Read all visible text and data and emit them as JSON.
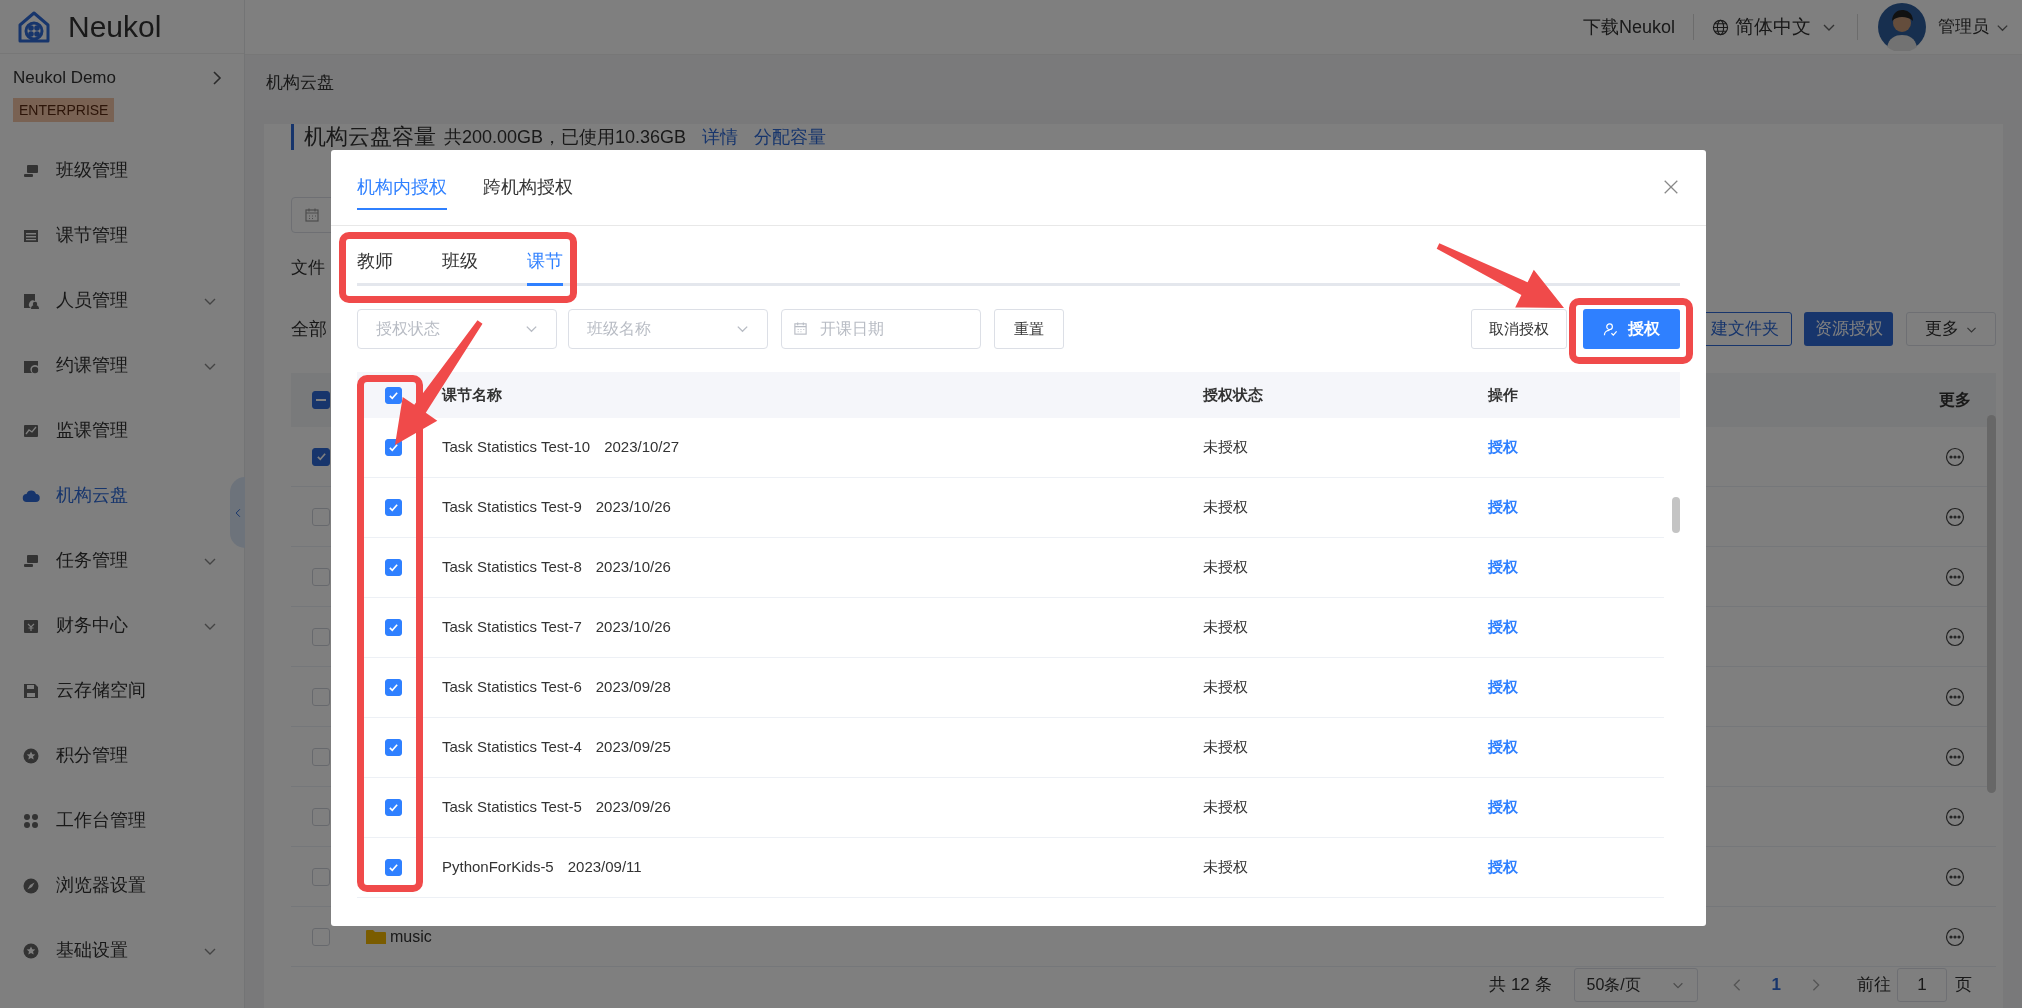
{
  "header": {
    "brand": "Neukol",
    "download": "下载Neukol",
    "language": "简体中文",
    "user": "管理员"
  },
  "sidebar": {
    "org": "Neukol Demo",
    "edition": "ENTERPRISE",
    "items": [
      {
        "label": "班级管理",
        "expandable": false,
        "selected": false
      },
      {
        "label": "课节管理",
        "expandable": false,
        "selected": false
      },
      {
        "label": "人员管理",
        "expandable": true,
        "selected": false
      },
      {
        "label": "约课管理",
        "expandable": true,
        "selected": false
      },
      {
        "label": "监课管理",
        "expandable": false,
        "selected": false
      },
      {
        "label": "机构云盘",
        "expandable": false,
        "selected": true
      },
      {
        "label": "任务管理",
        "expandable": true,
        "selected": false
      },
      {
        "label": "财务中心",
        "expandable": true,
        "selected": false
      },
      {
        "label": "云存储空间",
        "expandable": false,
        "selected": false
      },
      {
        "label": "积分管理",
        "expandable": false,
        "selected": false
      },
      {
        "label": "工作台管理",
        "expandable": false,
        "selected": false
      },
      {
        "label": "浏览器设置",
        "expandable": false,
        "selected": false
      },
      {
        "label": "基础设置",
        "expandable": true,
        "selected": false
      }
    ]
  },
  "breadcrumb": "机构云盘",
  "storage": {
    "title": "机构云盘容量",
    "usage": "共200.00GB，已使用10.36GB",
    "links": [
      "详情",
      "分配容量"
    ]
  },
  "file_label": "文件",
  "all_label": "全部",
  "actions": [
    {
      "label": "建文件夹",
      "kind": "outline"
    },
    {
      "label": "资源授权",
      "kind": "primary"
    },
    {
      "label": "更多",
      "kind": "dropdown"
    }
  ],
  "files": {
    "more_header": "更多",
    "header_indeterminate": true,
    "rows": [
      {
        "checked": true
      },
      {
        "checked": false
      },
      {
        "checked": false
      },
      {
        "checked": false
      },
      {
        "checked": false
      },
      {
        "checked": false
      },
      {
        "checked": false
      },
      {
        "checked": false
      },
      {
        "checked": false,
        "kind": "folder",
        "name": "music"
      }
    ]
  },
  "pagination": {
    "total": "共 12 条",
    "page_size": "50条/页",
    "pages": [
      {
        "label": "1",
        "selected": true
      }
    ],
    "goto_label": "前往",
    "goto_value": "1",
    "page_label": "页"
  },
  "dialog": {
    "tabs": [
      {
        "label": "机构内授权",
        "selected": true
      },
      {
        "label": "跨机构授权",
        "selected": false
      }
    ],
    "subtabs": [
      {
        "label": "教师",
        "selected": false
      },
      {
        "label": "班级",
        "selected": false
      },
      {
        "label": "课节",
        "selected": true
      }
    ],
    "filters": [
      {
        "kind": "select",
        "placeholder": "授权状态"
      },
      {
        "kind": "select",
        "placeholder": "班级名称"
      },
      {
        "kind": "date",
        "placeholder": "开课日期"
      }
    ],
    "reset": "重置",
    "revoke": "取消授权",
    "grant": "授权",
    "table": {
      "columns": [
        "课节名称",
        "授权状态",
        "操作"
      ],
      "all_checked": true,
      "rows": [
        {
          "name": "Task Statistics Test-10",
          "date": "2023/10/27",
          "status": "未授权",
          "action": "授权",
          "checked": true
        },
        {
          "name": "Task Statistics Test-9",
          "date": "2023/10/26",
          "status": "未授权",
          "action": "授权",
          "checked": true
        },
        {
          "name": "Task Statistics Test-8",
          "date": "2023/10/26",
          "status": "未授权",
          "action": "授权",
          "checked": true
        },
        {
          "name": "Task Statistics Test-7",
          "date": "2023/10/26",
          "status": "未授权",
          "action": "授权",
          "checked": true
        },
        {
          "name": "Task Statistics Test-6",
          "date": "2023/09/28",
          "status": "未授权",
          "action": "授权",
          "checked": true
        },
        {
          "name": "Task Statistics Test-4",
          "date": "2023/09/25",
          "status": "未授权",
          "action": "授权",
          "checked": true
        },
        {
          "name": "Task Statistics Test-5",
          "date": "2023/09/26",
          "status": "未授权",
          "action": "授权",
          "checked": true
        },
        {
          "name": "PythonForKids-5",
          "date": "2023/09/11",
          "status": "未授权",
          "action": "授权",
          "checked": true
        }
      ]
    }
  }
}
